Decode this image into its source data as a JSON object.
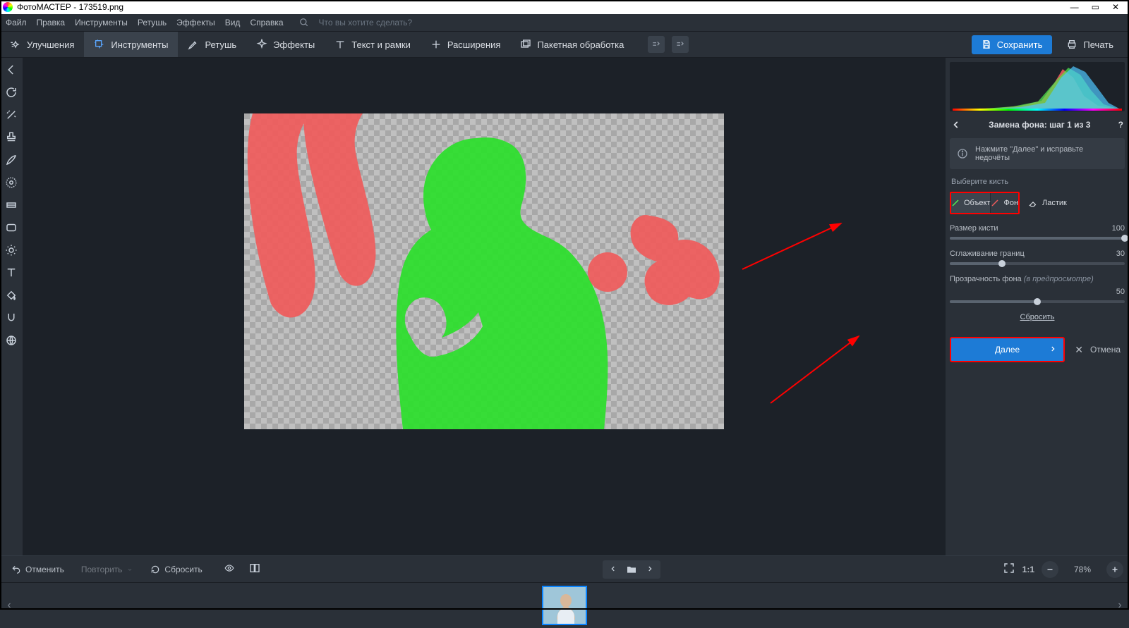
{
  "title_bar": {
    "app_name": "ФотоМАСТЕР",
    "file_name": "173519.png"
  },
  "window_controls": {
    "minimize": "—",
    "maximize": "▭",
    "close": "✕"
  },
  "menu_bar": {
    "items": [
      "Файл",
      "Правка",
      "Инструменты",
      "Ретушь",
      "Эффекты",
      "Вид",
      "Справка"
    ],
    "search_placeholder": "Что вы хотите сделать?"
  },
  "toolbar": {
    "improvements": "Улучшения",
    "tools": "Инструменты",
    "retouch": "Ретушь",
    "effects": "Эффекты",
    "text_frames": "Текст и рамки",
    "extensions": "Расширения",
    "batch": "Пакетная обработка",
    "save": "Сохранить",
    "print": "Печать"
  },
  "right_panel": {
    "step_title": "Замена фона: шаг 1 из 3",
    "hint": "Нажмите \"Далее\" и исправьте недочёты",
    "brush_label": "Выберите кисть",
    "brush_object": "Объект",
    "brush_bg": "Фон",
    "brush_eraser": "Ластик",
    "brush_size_label": "Размер кисти",
    "brush_size_value": "100",
    "smooth_label": "Сглаживание границ",
    "smooth_value": "30",
    "opacity_label": "Прозрачность фона",
    "opacity_note": "(в предпросмотре)",
    "opacity_value": "50",
    "reset": "Сбросить",
    "next": "Далее",
    "cancel": "Отмена"
  },
  "bottom_bar": {
    "undo": "Отменить",
    "redo": "Повторить",
    "reset_all": "Сбросить",
    "ratio": "1:1",
    "zoom": "78%"
  }
}
